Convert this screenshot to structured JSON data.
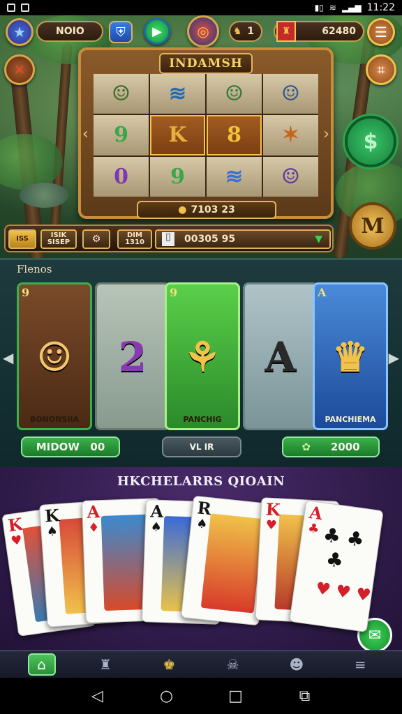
{
  "statusbar": {
    "time": "11:22",
    "battery": "B",
    "signal": "▮"
  },
  "hud": {
    "player_name": "NOIO",
    "level_value": "1",
    "coins_value": "62480",
    "star_icon": "star-icon"
  },
  "machine": {
    "title": "INDAMSH",
    "footer_value": "7103 23",
    "win_text": "K8",
    "grid": [
      {
        "glyph": "☺",
        "color": "#3b6b2a"
      },
      {
        "glyph": "≋",
        "color": "#2b6ab0"
      },
      {
        "glyph": "☺",
        "color": "#2f7a3a"
      },
      {
        "glyph": "☺",
        "color": "#2d5a8a"
      },
      {
        "glyph": "9",
        "color": "#3aa648"
      },
      {
        "glyph": "K",
        "color": "#e7b03a"
      },
      {
        "glyph": "8",
        "color": "#f2c23a"
      },
      {
        "glyph": "✶",
        "color": "#c6651c"
      },
      {
        "glyph": "0",
        "color": "#7a3ab0"
      },
      {
        "glyph": "9",
        "color": "#3aa648"
      },
      {
        "glyph": "≋",
        "color": "#3b6fd0"
      },
      {
        "glyph": "☺",
        "color": "#5a3a9a"
      }
    ]
  },
  "betbar": {
    "chip1": "ISS",
    "chip2_top": "ISIK",
    "chip2_bottom": "SISEP",
    "chip3_top": "DIM",
    "chip3_bottom": "1310",
    "total": "00305 95"
  },
  "section2": {
    "title": "Flenos",
    "cards": [
      {
        "label": "BONONSIIA",
        "corner": "9",
        "glyph": "☺"
      },
      {
        "label": "",
        "corner": "",
        "glyph": "2"
      },
      {
        "label": "PANCHIG",
        "corner": "9",
        "glyph": "⚘"
      },
      {
        "label": "",
        "corner": "",
        "glyph": "A"
      },
      {
        "label": "PANCHIEMA",
        "corner": "A",
        "glyph": "♛"
      }
    ],
    "btn_left_label": "MIDOW",
    "btn_left_value": "00",
    "btn_mid_label": "VL IR",
    "btn_right_value": "2000"
  },
  "section3": {
    "title": "HKCHELARRS QIOAIN",
    "cards": [
      {
        "rank": "K",
        "suit": "♥",
        "color": "red"
      },
      {
        "rank": "K",
        "suit": "♠",
        "color": "black"
      },
      {
        "rank": "A",
        "suit": "♦",
        "color": "red"
      },
      {
        "rank": "A",
        "suit": "♠",
        "color": "black"
      },
      {
        "rank": "R",
        "suit": "♠",
        "color": "black"
      },
      {
        "rank": "K",
        "suit": "♥",
        "color": "red"
      },
      {
        "rank": "A",
        "suit": "♣",
        "color": "red"
      }
    ]
  },
  "bottomnav": {
    "items": [
      "home-icon",
      "trophy-icon",
      "king-icon",
      "crossbones-icon",
      "friends-icon",
      "menu-icon"
    ]
  }
}
